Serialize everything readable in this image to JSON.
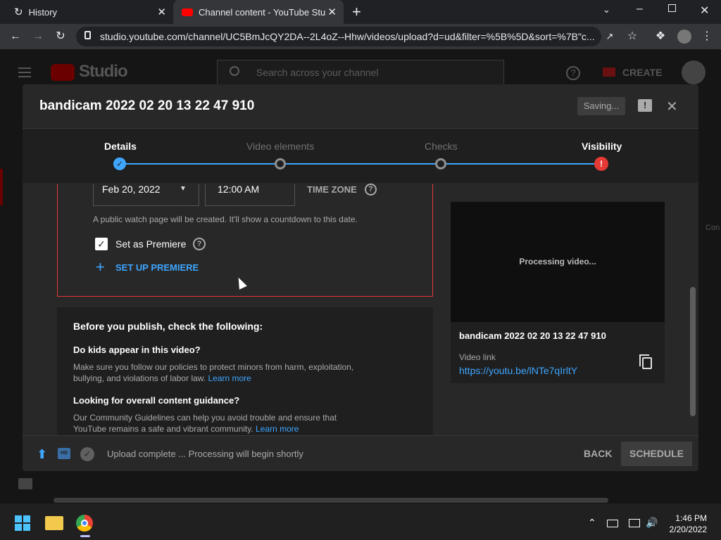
{
  "browser": {
    "tabs": [
      {
        "label": "History",
        "active": false
      },
      {
        "label": "Channel content - YouTube Studio",
        "active": true
      }
    ],
    "url": "studio.youtube.com/channel/UC5BmJcQY2DA--2L4oZ--Hhw/videos/upload?d=ud&filter=%5B%5D&sort=%7B\"c...",
    "new_tab_label": "+"
  },
  "studio": {
    "logo": "Studio",
    "search_placeholder": "Search across your channel",
    "create_label": "CREATE",
    "side_peek": "Con"
  },
  "dialog": {
    "title": "bandicam 2022 02 20 13 22 47 910",
    "saving_label": "Saving...",
    "steps": [
      {
        "label": "Details",
        "state": "done"
      },
      {
        "label": "Video elements",
        "state": "pending"
      },
      {
        "label": "Checks",
        "state": "pending"
      },
      {
        "label": "Visibility",
        "state": "error"
      }
    ],
    "schedule": {
      "date": "Feb 20, 2022",
      "time": "12:00 AM",
      "timezone_label": "TIME ZONE",
      "note": "A public watch page will be created. It'll show a countdown to this date.",
      "premiere_label": "Set as Premiere",
      "premiere_checked": true,
      "setup_premiere": "SET UP PREMIERE"
    },
    "checklist": {
      "heading": "Before you publish, check the following:",
      "q1": "Do kids appear in this video?",
      "a1": "Make sure you follow our policies to protect minors from harm, exploitation, bullying, and violations of labor law.",
      "a1_link": "Learn more",
      "q2": "Looking for overall content guidance?",
      "a2": "Our Community Guidelines can help you avoid trouble and ensure that YouTube remains a safe and vibrant community.",
      "a2_link": "Learn more"
    },
    "preview": {
      "processing": "Processing video...",
      "filename": "bandicam 2022 02 20 13 22 47 910",
      "link_label": "Video link",
      "link": "https://youtu.be/lNTe7qIrltY"
    },
    "footer": {
      "status": "Upload complete ... Processing will begin shortly",
      "hd_badge": "HD",
      "back_label": "BACK",
      "schedule_label": "SCHEDULE"
    }
  },
  "taskbar": {
    "time": "1:46 PM",
    "date": "2/20/2022"
  },
  "colors": {
    "accent_blue": "#3ea6ff",
    "error_red": "#e53935",
    "youtube_red": "#ff0000"
  }
}
